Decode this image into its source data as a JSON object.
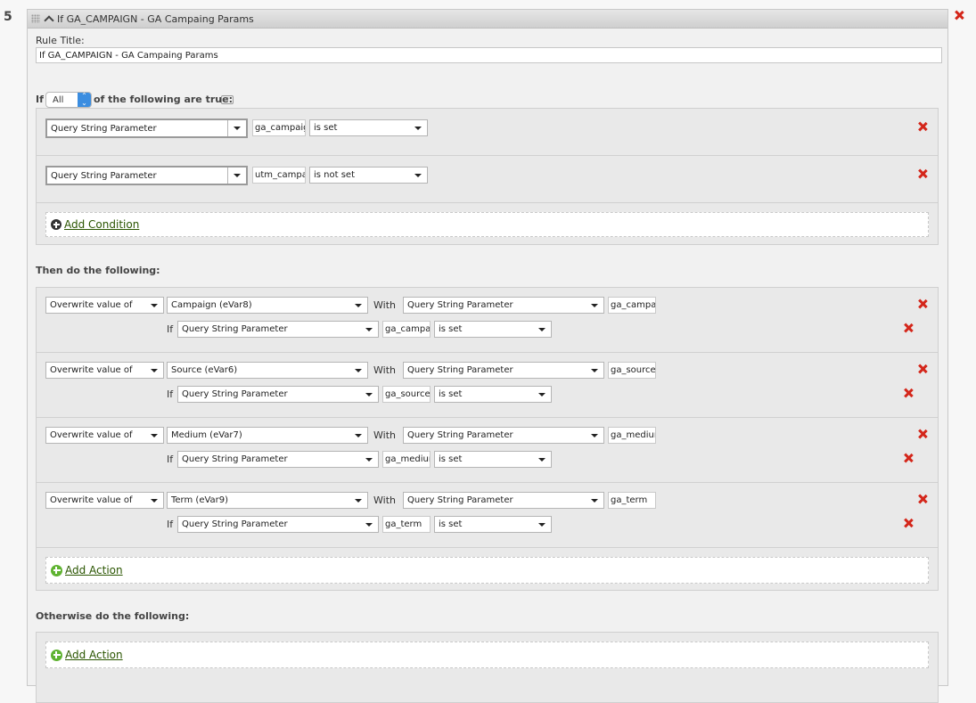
{
  "rule": {
    "number": "5",
    "header_title": "If GA_CAMPAIGN - GA Campaing Params",
    "title_label": "Rule Title:",
    "title_value": "If GA_CAMPAIGN - GA Campaing Params"
  },
  "conditions": {
    "if_label": "If",
    "match_select": "All",
    "suffix_label": "of the following are true:",
    "help_icon": "?",
    "rows": [
      {
        "type": "Query String Parameter",
        "param": "ga_campaign",
        "operator": "is set"
      },
      {
        "type": "Query String Parameter",
        "param": "utm_campaign",
        "operator": "is not set"
      }
    ],
    "add_label": "Add Condition"
  },
  "then": {
    "heading": "Then do the following:",
    "with_label": "With",
    "if_label": "If",
    "actions": [
      {
        "action": "Overwrite value of",
        "variable": "Campaign (eVar8)",
        "source": "Query String Parameter",
        "source_param": "ga_campaign",
        "cond_type": "Query String Parameter",
        "cond_param": "ga_campaign",
        "cond_operator": "is set"
      },
      {
        "action": "Overwrite value of",
        "variable": "Source (eVar6)",
        "source": "Query String Parameter",
        "source_param": "ga_source",
        "cond_type": "Query String Parameter",
        "cond_param": "ga_source",
        "cond_operator": "is set"
      },
      {
        "action": "Overwrite value of",
        "variable": "Medium (eVar7)",
        "source": "Query String Parameter",
        "source_param": "ga_medium",
        "cond_type": "Query String Parameter",
        "cond_param": "ga_medium",
        "cond_operator": "is set"
      },
      {
        "action": "Overwrite value of",
        "variable": "Term (eVar9)",
        "source": "Query String Parameter",
        "source_param": "ga_term",
        "cond_type": "Query String Parameter",
        "cond_param": "ga_term",
        "cond_operator": "is set"
      }
    ],
    "add_label": "Add Action"
  },
  "otherwise": {
    "heading": "Otherwise do the following:",
    "add_label": "Add Action"
  },
  "colors": {
    "remove": "#d4261a",
    "add_action_icon": "#5fb331",
    "link": "#2a5500",
    "select_accent": "#3b8de0"
  }
}
